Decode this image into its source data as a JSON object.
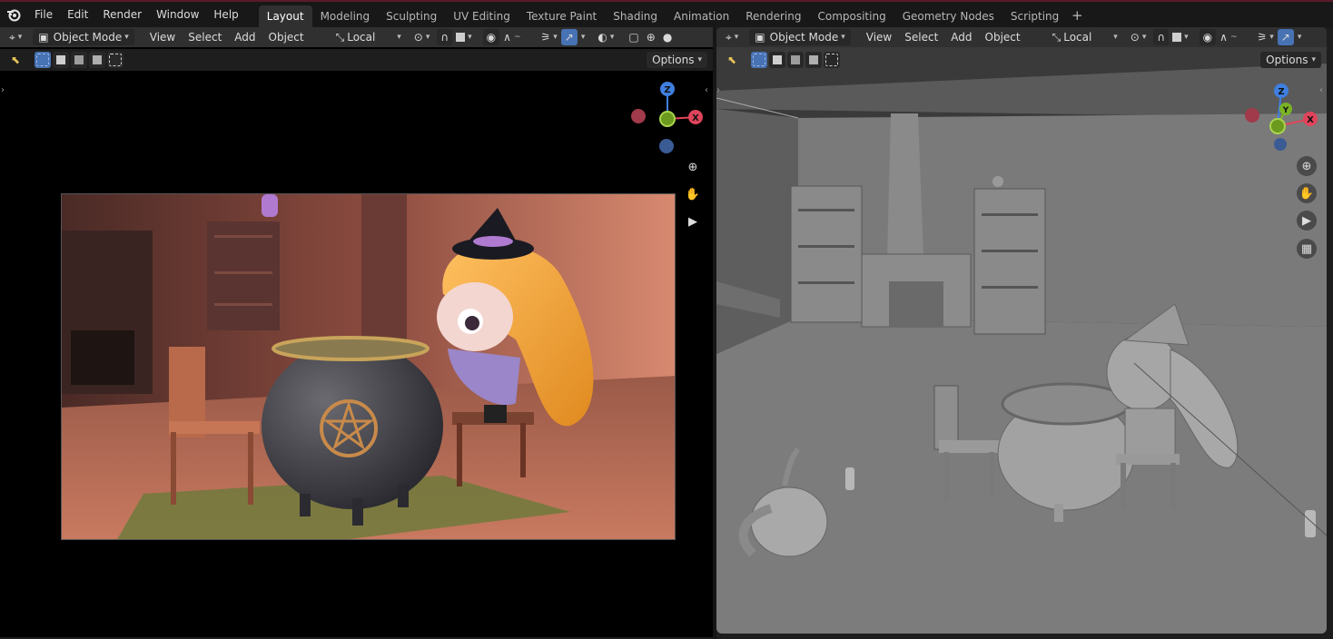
{
  "topbar": {
    "menus": [
      "File",
      "Edit",
      "Render",
      "Window",
      "Help"
    ],
    "workspaces": [
      "Layout",
      "Modeling",
      "Sculpting",
      "UV Editing",
      "Texture Paint",
      "Shading",
      "Animation",
      "Rendering",
      "Compositing",
      "Geometry Nodes",
      "Scripting"
    ],
    "active_workspace": "Layout",
    "add_label": "+"
  },
  "left_view": {
    "mode": "Object Mode",
    "menus": [
      "View",
      "Select",
      "Add",
      "Object"
    ],
    "orientation": "Local",
    "options": "Options"
  },
  "right_view": {
    "mode": "Object Mode",
    "menus": [
      "View",
      "Select",
      "Add",
      "Object"
    ],
    "orientation": "Local",
    "options": "Options"
  },
  "gizmo": {
    "z": "Z",
    "x": "X",
    "y": "Y"
  },
  "colors": {
    "accent": "#4772b3",
    "axis_x": "#e0445a",
    "axis_y": "#7bb324",
    "axis_z": "#3f7fe0",
    "topbar_border": "#5a1a2a"
  }
}
